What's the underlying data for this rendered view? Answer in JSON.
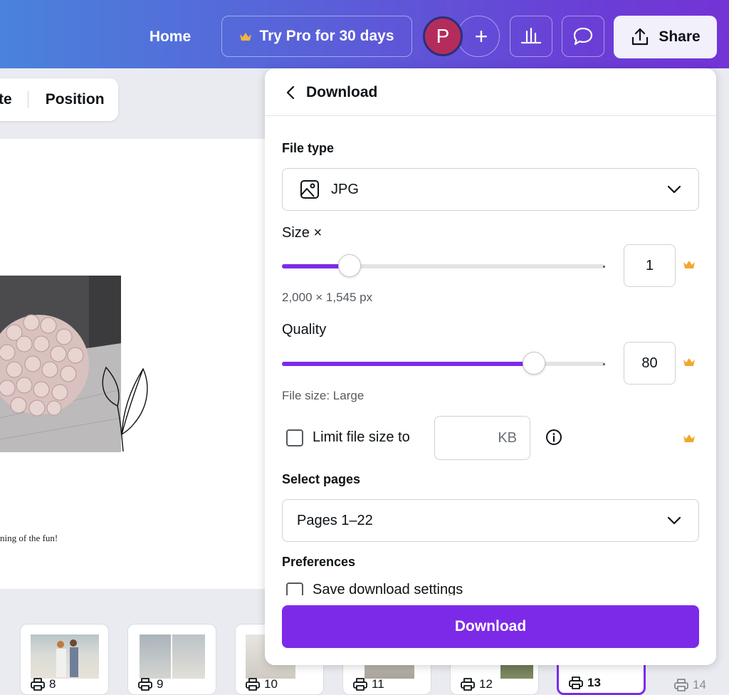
{
  "topbar": {
    "home_label": "Home",
    "try_pro_label": "Try Pro for 30 days",
    "avatar_initial": "P",
    "add_label": "+",
    "share_label": "Share"
  },
  "toolbar": {
    "fragment_label": "te",
    "position_label": "Position"
  },
  "canvas": {
    "caption_text": "ning of the fun!"
  },
  "thumbnails": [
    {
      "page": "8",
      "active": false
    },
    {
      "page": "9",
      "active": false
    },
    {
      "page": "10",
      "active": false
    },
    {
      "page": "11",
      "active": false
    },
    {
      "page": "12",
      "active": false
    },
    {
      "page": "13",
      "active": true
    },
    {
      "page": "14",
      "active": false
    }
  ],
  "download_panel": {
    "title": "Download",
    "file_type_label": "File type",
    "file_type_value": "JPG",
    "size_label": "Size ×",
    "size_value": "1",
    "size_slider_fraction": 0.21,
    "dimensions_text": "2,000 × 1,545 px",
    "quality_label": "Quality",
    "quality_value": "80",
    "quality_slider_fraction": 0.78,
    "file_size_text": "File size: Large",
    "limit_label": "Limit file size to",
    "limit_placeholder": "KB",
    "select_pages_label": "Select pages",
    "pages_value": "Pages 1–22",
    "preferences_label": "Preferences",
    "save_settings_label": "Save download settings",
    "download_button_label": "Download"
  },
  "colors": {
    "accent": "#7d2ae8",
    "crown": "#f0a830",
    "avatar": "#b42c5c"
  }
}
